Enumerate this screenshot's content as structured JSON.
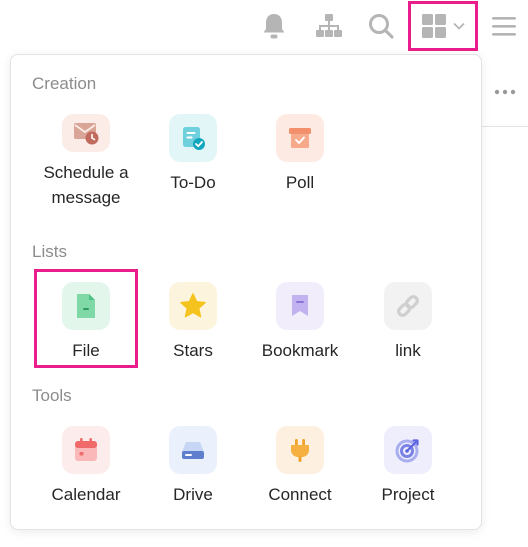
{
  "sections": {
    "creation": {
      "title": "Creation",
      "items": [
        {
          "label": "Schedule a message",
          "icon": "schedule-message-icon"
        },
        {
          "label": "To-Do",
          "icon": "todo-icon"
        },
        {
          "label": "Poll",
          "icon": "poll-icon"
        }
      ]
    },
    "lists": {
      "title": "Lists",
      "items": [
        {
          "label": "File",
          "icon": "file-icon"
        },
        {
          "label": "Stars",
          "icon": "star-icon"
        },
        {
          "label": "Bookmark",
          "icon": "bookmark-icon"
        },
        {
          "label": "link",
          "icon": "link-icon"
        }
      ]
    },
    "tools": {
      "title": "Tools",
      "items": [
        {
          "label": "Calendar",
          "icon": "calendar-icon"
        },
        {
          "label": "Drive",
          "icon": "drive-icon"
        },
        {
          "label": "Connect",
          "icon": "connect-icon"
        },
        {
          "label": "Project",
          "icon": "project-icon"
        }
      ]
    }
  },
  "colors": {
    "highlight": "#e91e8c",
    "toolbar_icon": "#b5b5b5"
  }
}
